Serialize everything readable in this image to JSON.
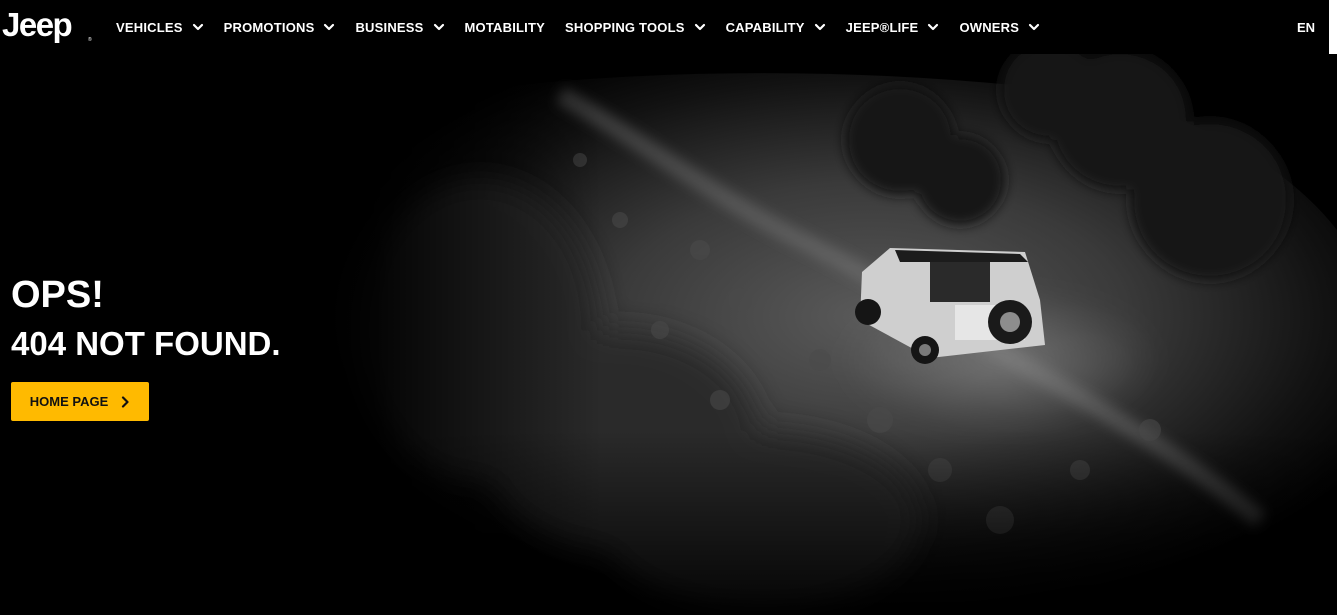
{
  "brand": {
    "logo_text": "Jeep",
    "logo_mark": "®"
  },
  "nav": {
    "items": [
      {
        "label": "VEHICLES",
        "has_dropdown": true
      },
      {
        "label": "PROMOTIONS",
        "has_dropdown": true
      },
      {
        "label": "BUSINESS",
        "has_dropdown": true
      },
      {
        "label": "MOTABILITY",
        "has_dropdown": false
      },
      {
        "label": "SHOPPING TOOLS",
        "has_dropdown": true
      },
      {
        "label": "CAPABILITY",
        "has_dropdown": true
      },
      {
        "label": "JEEP®LIFE",
        "has_dropdown": true
      },
      {
        "label": "OWNERS",
        "has_dropdown": true
      }
    ],
    "language": "EN"
  },
  "error": {
    "heading": "OPS!",
    "subheading": "404 NOT FOUND.",
    "button_label": "HOME PAGE"
  },
  "colors": {
    "accent": "#ffba00",
    "background": "#000000",
    "text": "#ffffff"
  },
  "icons": {
    "dropdown": "chevron-down-icon",
    "button_arrow": "chevron-right-icon"
  }
}
